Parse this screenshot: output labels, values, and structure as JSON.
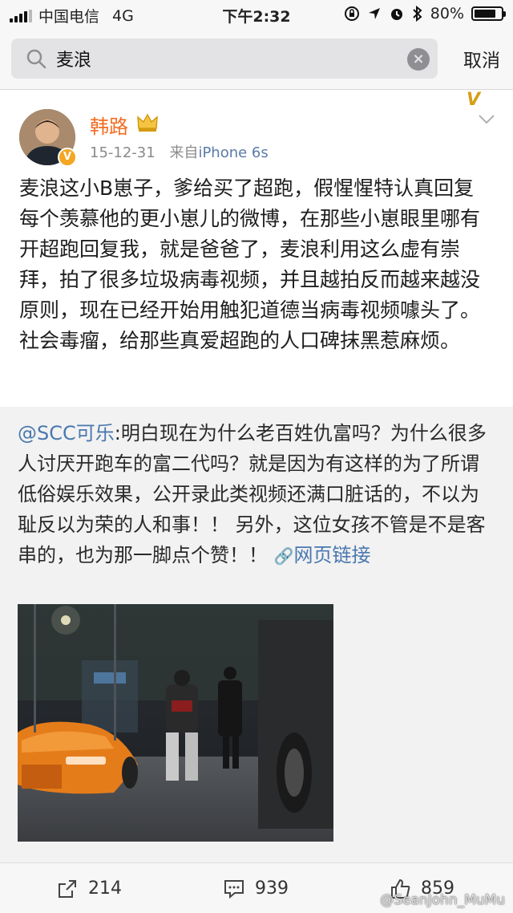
{
  "status_bar": {
    "carrier": "中国电信",
    "network": "4G",
    "time": "下午2:32",
    "battery_percent": "80%",
    "battery_level": 0.8,
    "icons": [
      "signal-icon",
      "lock-rotation-icon",
      "location-icon",
      "alarm-icon",
      "bluetooth-icon",
      "battery-icon"
    ]
  },
  "search": {
    "query": "麦浪",
    "cancel_label": "取消"
  },
  "post": {
    "author": "韩路",
    "date": "15-12-31",
    "source_prefix": "来自",
    "source": "iPhone 6s",
    "text": "麦浪这小B崽子，爹给买了超跑，假惺惺特认真回复每个羡慕他的更小崽儿的微博，在那些小崽眼里哪有开超跑回复我，就是爸爸了，麦浪利用这么虚有崇拜，拍了很多垃圾病毒视频，并且越拍反而越来越没原则，现在已经开始用触犯道德当病毒视频噱头了。社会毒瘤，给那些真爱超跑的人口碑抹黑惹麻烦。"
  },
  "repost": {
    "mention": "@SCC可乐",
    "text": ":明白现在为什么老百姓仇富吗？为什么很多人讨厌开跑车的富二代吗？就是因为有这样的为了所谓低俗娱乐效果，公开录此类视频还满口脏话的，不以为耻反以为荣的人和事！！ 另外，这位女孩不管是不是客串的，也为那一脚点个赞！！",
    "link_label": "网页链接"
  },
  "actions": {
    "repost_count": "214",
    "comment_count": "939",
    "like_count": "859"
  },
  "credit": "@SeanJohn_MuMu",
  "colors": {
    "author": "#f36c21",
    "link": "#4a78b0",
    "meta": "#8a8a8a"
  }
}
